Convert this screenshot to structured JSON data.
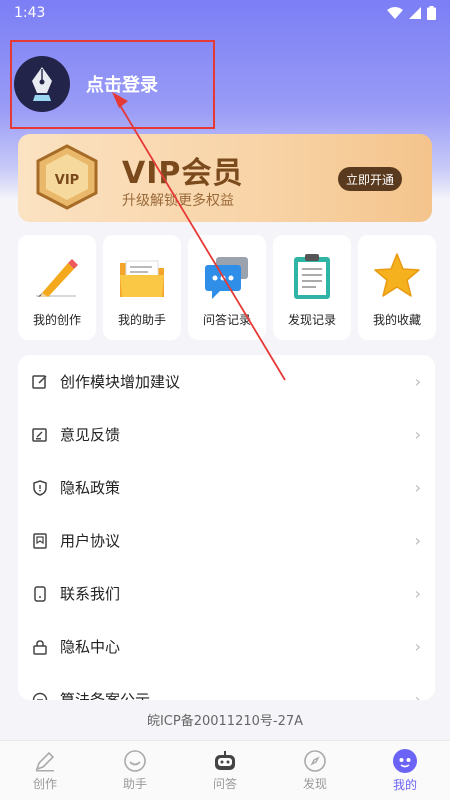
{
  "status_bar": {
    "time": "1:43"
  },
  "profile": {
    "login_text": "点击登录"
  },
  "vip": {
    "badge_text": "VIP",
    "title": "VIP会员",
    "subtitle": "升级解锁更多权益",
    "button": "立即开通"
  },
  "quick_actions": [
    {
      "label": "我的创作",
      "icon": "pencil-icon"
    },
    {
      "label": "我的助手",
      "icon": "folder-icon"
    },
    {
      "label": "问答记录",
      "icon": "chat-bubble-icon"
    },
    {
      "label": "发现记录",
      "icon": "clipboard-icon"
    },
    {
      "label": "我的收藏",
      "icon": "star-icon"
    }
  ],
  "menu": [
    {
      "label": "创作模块增加建议",
      "icon": "edit-icon"
    },
    {
      "label": "意见反馈",
      "icon": "feedback-icon"
    },
    {
      "label": "隐私政策",
      "icon": "shield-icon"
    },
    {
      "label": "用户协议",
      "icon": "bookmark-icon"
    },
    {
      "label": "联系我们",
      "icon": "phone-icon"
    },
    {
      "label": "隐私中心",
      "icon": "lock-icon"
    },
    {
      "label": "算法备案公示",
      "icon": "algorithm-icon"
    }
  ],
  "icp": "皖ICP备20011210号-27A",
  "tabs": [
    {
      "label": "创作",
      "icon": "pen-icon"
    },
    {
      "label": "助手",
      "icon": "smile-icon"
    },
    {
      "label": "问答",
      "icon": "robot-icon"
    },
    {
      "label": "发现",
      "icon": "compass-icon"
    },
    {
      "label": "我的",
      "icon": "profile-icon",
      "active": true
    }
  ],
  "colors": {
    "accent": "#6b63f6",
    "highlight": "#e53935",
    "vip_dark": "#5a3a1e"
  }
}
